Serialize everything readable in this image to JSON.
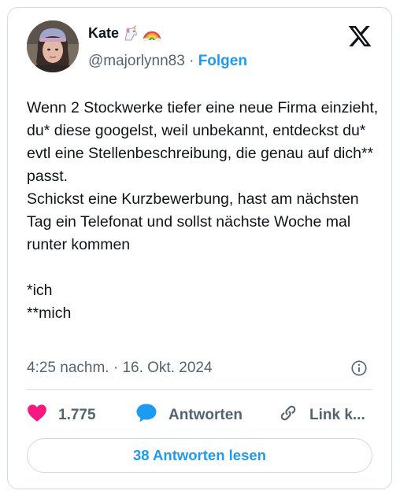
{
  "author": {
    "name": "Kate",
    "name_emojis": [
      "unicorn-emoji",
      "rainbow-emoji"
    ],
    "handle": "@majorlynn83",
    "separator": "·",
    "follow_label": "Folgen"
  },
  "platform_logo": "x-logo-icon",
  "tweet": {
    "text": "Wenn 2 Stockwerke tiefer eine neue Firma einzieht, du* diese googelst, weil unbekannt, entdeckst du* evtl eine Stellenbeschreibung, die genau auf dich** passt.\nSchickst eine Kurzbewerbung, hast am nächsten Tag ein Telefonat und sollst nächste Woche mal runter kommen\n\n*ich\n**mich",
    "timestamp": "4:25 nachm. · 16. Okt. 2024"
  },
  "actions": {
    "like_count": "1.775",
    "reply_label": "Antworten",
    "copy_link_label": "Link k..."
  },
  "read_replies_label": "38 Antworten lesen",
  "colors": {
    "accent": "#1d9bf0",
    "like": "#f91880",
    "text": "#0f1419",
    "muted": "#536471",
    "border": "#cfd9de"
  }
}
